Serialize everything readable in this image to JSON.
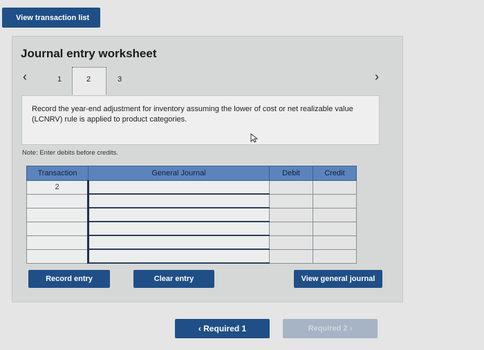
{
  "toolbar": {
    "view_transaction_list": "View transaction list"
  },
  "worksheet": {
    "title": "Journal entry worksheet",
    "steps": [
      "1",
      "2",
      "3"
    ],
    "current_step": "2",
    "prev_icon": "chevron-left-icon",
    "next_icon": "chevron-right-icon",
    "instruction": "Record the year-end adjustment for inventory assuming the lower of cost or net realizable value (LCNRV) rule is applied to product categories.",
    "note": "Note: Enter debits before credits."
  },
  "table": {
    "headers": {
      "transaction": "Transaction",
      "general_journal": "General Journal",
      "debit": "Debit",
      "credit": "Credit"
    },
    "rows": [
      {
        "transaction": "2",
        "account": "",
        "debit": "",
        "credit": ""
      },
      {
        "transaction": "",
        "account": "",
        "debit": "",
        "credit": ""
      },
      {
        "transaction": "",
        "account": "",
        "debit": "",
        "credit": ""
      },
      {
        "transaction": "",
        "account": "",
        "debit": "",
        "credit": ""
      },
      {
        "transaction": "",
        "account": "",
        "debit": "",
        "credit": ""
      },
      {
        "transaction": "",
        "account": "",
        "debit": "",
        "credit": ""
      }
    ]
  },
  "actions": {
    "record_entry": "Record entry",
    "clear_entry": "Clear entry",
    "view_general_journal": "View general journal"
  },
  "pager": {
    "prev_label": "‹  Required 1",
    "next_label": "Required 2  ›"
  },
  "colors": {
    "button_blue": "#1f4f86",
    "header_blue": "#5b84bd"
  }
}
